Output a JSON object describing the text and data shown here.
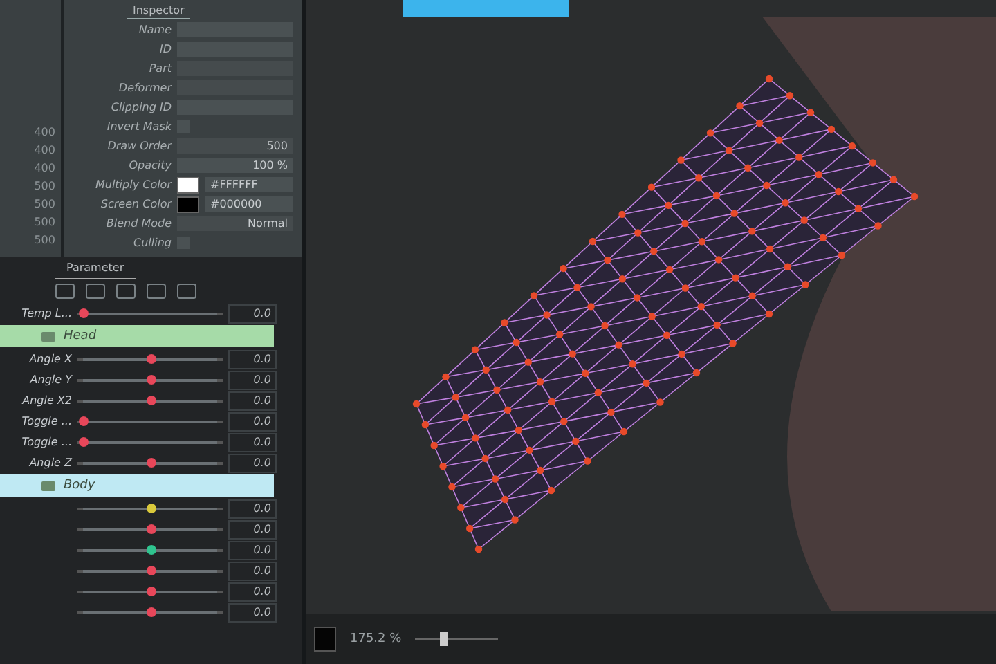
{
  "list_column": [
    "400",
    "400",
    "400",
    "500",
    "500",
    "500",
    "500"
  ],
  "inspector": {
    "tab": "Inspector",
    "rows": [
      {
        "label": "Name",
        "kind": "text",
        "value": ""
      },
      {
        "label": "ID",
        "kind": "text",
        "value": ""
      },
      {
        "label": "Part",
        "kind": "dropdown",
        "value": ""
      },
      {
        "label": "Deformer",
        "kind": "dropdown",
        "value": ""
      },
      {
        "label": "Clipping ID",
        "kind": "text",
        "value": ""
      },
      {
        "label": "Invert Mask",
        "kind": "checkbox",
        "checked": false
      },
      {
        "label": "Draw Order",
        "kind": "dropdown",
        "value": "500"
      },
      {
        "label": "Opacity",
        "kind": "text",
        "value": "100 %"
      },
      {
        "label": "Multiply Color",
        "kind": "color",
        "value": "#FFFFFF",
        "color": "#ffffff"
      },
      {
        "label": "Screen Color",
        "kind": "color",
        "value": "#000000",
        "color": "#000000"
      },
      {
        "label": "Blend Mode",
        "kind": "dropdown",
        "value": "Normal"
      },
      {
        "label": "Culling",
        "kind": "checkbox",
        "checked": false
      }
    ]
  },
  "parameter": {
    "tab": "Parameter",
    "rows": [
      {
        "kind": "slider",
        "name": "Temp L...",
        "level": 0.0,
        "value": "0.0",
        "color": "#e8475a"
      },
      {
        "kind": "group",
        "name": "Head",
        "color": "#a6dba8"
      },
      {
        "kind": "slider",
        "name": "Angle X",
        "level": 0.5,
        "value": "0.0",
        "color": "#e8475a"
      },
      {
        "kind": "slider",
        "name": "Angle Y",
        "level": 0.5,
        "value": "0.0",
        "color": "#e8475a"
      },
      {
        "kind": "slider",
        "name": "Angle X2",
        "level": 0.5,
        "value": "0.0",
        "color": "#e8475a"
      },
      {
        "kind": "slider",
        "name": "Toggle ...",
        "level": 0.0,
        "value": "0.0",
        "color": "#e8475a"
      },
      {
        "kind": "slider",
        "name": "Toggle ...",
        "level": 0.0,
        "value": "0.0",
        "color": "#e8475a"
      },
      {
        "kind": "slider",
        "name": "Angle Z",
        "level": 0.5,
        "value": "0.0",
        "color": "#e8475a"
      },
      {
        "kind": "group",
        "name": "Body",
        "color": "#bfe9f3"
      },
      {
        "kind": "slider",
        "name": "",
        "level": 0.5,
        "value": "0.0",
        "color": "#d9c93b"
      },
      {
        "kind": "slider",
        "name": "",
        "level": 0.5,
        "value": "0.0",
        "color": "#e8475a"
      },
      {
        "kind": "slider",
        "name": "",
        "level": 0.5,
        "value": "0.0",
        "color": "#2fc48f"
      },
      {
        "kind": "slider",
        "name": "",
        "level": 0.5,
        "value": "0.0",
        "color": "#e8475a"
      },
      {
        "kind": "slider",
        "name": "",
        "level": 0.5,
        "value": "0.0",
        "color": "#e8475a"
      },
      {
        "kind": "slider",
        "name": "",
        "level": 0.5,
        "value": "0.0",
        "color": "#e8475a"
      }
    ]
  },
  "status_bar": {
    "zoom": "175.2 %",
    "zoom_level": {
      "level": 0.35
    }
  }
}
